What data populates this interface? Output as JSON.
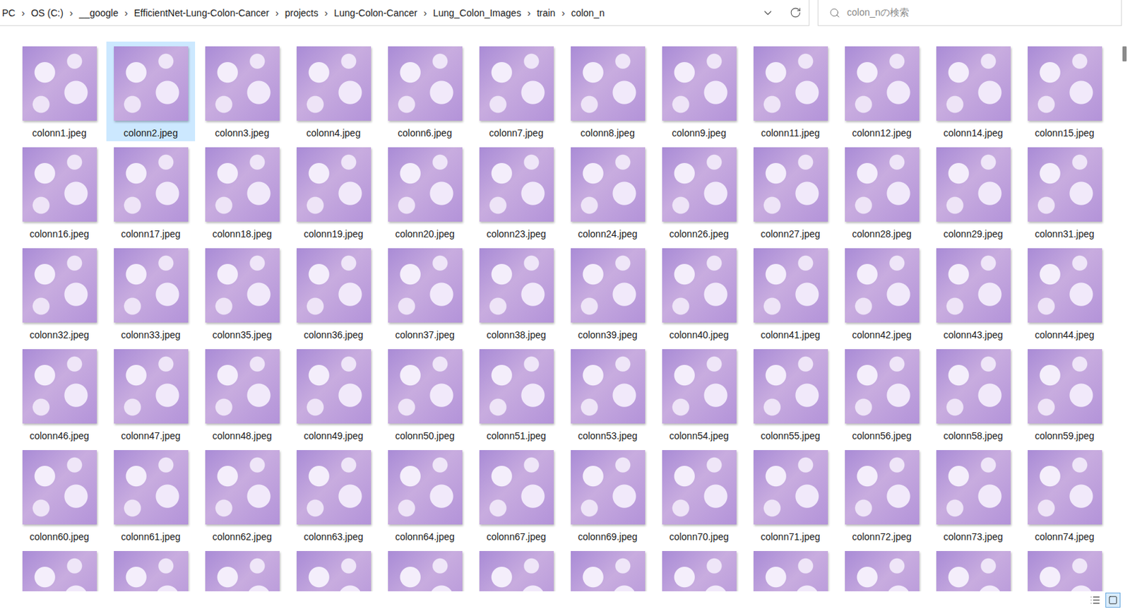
{
  "address_bar": {
    "separator": "›",
    "crumbs": [
      "PC",
      "OS (C:)",
      "__google",
      "EfficientNet-Lung-Colon-Cancer",
      "projects",
      "Lung-Colon-Cancer",
      "Lung_Colon_Images",
      "train",
      "colon_n"
    ]
  },
  "search": {
    "placeholder": "colon_nの検索"
  },
  "files": [
    {
      "name": "colonn1.jpeg",
      "selected": false
    },
    {
      "name": "colonn2.jpeg",
      "selected": true
    },
    {
      "name": "colonn3.jpeg",
      "selected": false
    },
    {
      "name": "colonn4.jpeg",
      "selected": false
    },
    {
      "name": "colonn6.jpeg",
      "selected": false
    },
    {
      "name": "colonn7.jpeg",
      "selected": false
    },
    {
      "name": "colonn8.jpeg",
      "selected": false
    },
    {
      "name": "colonn9.jpeg",
      "selected": false
    },
    {
      "name": "colonn11.jpeg",
      "selected": false
    },
    {
      "name": "colonn12.jpeg",
      "selected": false
    },
    {
      "name": "colonn14.jpeg",
      "selected": false
    },
    {
      "name": "colonn15.jpeg",
      "selected": false
    },
    {
      "name": "colonn16.jpeg",
      "selected": false
    },
    {
      "name": "colonn17.jpeg",
      "selected": false
    },
    {
      "name": "colonn18.jpeg",
      "selected": false
    },
    {
      "name": "colonn19.jpeg",
      "selected": false
    },
    {
      "name": "colonn20.jpeg",
      "selected": false
    },
    {
      "name": "colonn23.jpeg",
      "selected": false
    },
    {
      "name": "colonn24.jpeg",
      "selected": false
    },
    {
      "name": "colonn26.jpeg",
      "selected": false
    },
    {
      "name": "colonn27.jpeg",
      "selected": false
    },
    {
      "name": "colonn28.jpeg",
      "selected": false
    },
    {
      "name": "colonn29.jpeg",
      "selected": false
    },
    {
      "name": "colonn31.jpeg",
      "selected": false
    },
    {
      "name": "colonn32.jpeg",
      "selected": false
    },
    {
      "name": "colonn33.jpeg",
      "selected": false
    },
    {
      "name": "colonn35.jpeg",
      "selected": false
    },
    {
      "name": "colonn36.jpeg",
      "selected": false
    },
    {
      "name": "colonn37.jpeg",
      "selected": false
    },
    {
      "name": "colonn38.jpeg",
      "selected": false
    },
    {
      "name": "colonn39.jpeg",
      "selected": false
    },
    {
      "name": "colonn40.jpeg",
      "selected": false
    },
    {
      "name": "colonn41.jpeg",
      "selected": false
    },
    {
      "name": "colonn42.jpeg",
      "selected": false
    },
    {
      "name": "colonn43.jpeg",
      "selected": false
    },
    {
      "name": "colonn44.jpeg",
      "selected": false
    },
    {
      "name": "colonn46.jpeg",
      "selected": false
    },
    {
      "name": "colonn47.jpeg",
      "selected": false
    },
    {
      "name": "colonn48.jpeg",
      "selected": false
    },
    {
      "name": "colonn49.jpeg",
      "selected": false
    },
    {
      "name": "colonn50.jpeg",
      "selected": false
    },
    {
      "name": "colonn51.jpeg",
      "selected": false
    },
    {
      "name": "colonn53.jpeg",
      "selected": false
    },
    {
      "name": "colonn54.jpeg",
      "selected": false
    },
    {
      "name": "colonn55.jpeg",
      "selected": false
    },
    {
      "name": "colonn56.jpeg",
      "selected": false
    },
    {
      "name": "colonn58.jpeg",
      "selected": false
    },
    {
      "name": "colonn59.jpeg",
      "selected": false
    },
    {
      "name": "colonn60.jpeg",
      "selected": false
    },
    {
      "name": "colonn61.jpeg",
      "selected": false
    },
    {
      "name": "colonn62.jpeg",
      "selected": false
    },
    {
      "name": "colonn63.jpeg",
      "selected": false
    },
    {
      "name": "colonn64.jpeg",
      "selected": false
    },
    {
      "name": "colonn67.jpeg",
      "selected": false
    },
    {
      "name": "colonn69.jpeg",
      "selected": false
    },
    {
      "name": "colonn70.jpeg",
      "selected": false
    },
    {
      "name": "colonn71.jpeg",
      "selected": false
    },
    {
      "name": "colonn72.jpeg",
      "selected": false
    },
    {
      "name": "colonn73.jpeg",
      "selected": false
    },
    {
      "name": "colonn74.jpeg",
      "selected": false
    },
    {
      "name": "",
      "selected": false
    },
    {
      "name": "",
      "selected": false
    },
    {
      "name": "",
      "selected": false
    },
    {
      "name": "",
      "selected": false
    },
    {
      "name": "",
      "selected": false
    },
    {
      "name": "",
      "selected": false
    },
    {
      "name": "",
      "selected": false
    },
    {
      "name": "",
      "selected": false
    },
    {
      "name": "",
      "selected": false
    },
    {
      "name": "",
      "selected": false
    },
    {
      "name": "",
      "selected": false
    },
    {
      "name": "",
      "selected": false
    }
  ],
  "view_modes": [
    {
      "kind": "details",
      "selected": false
    },
    {
      "kind": "large-icons",
      "selected": true
    }
  ]
}
